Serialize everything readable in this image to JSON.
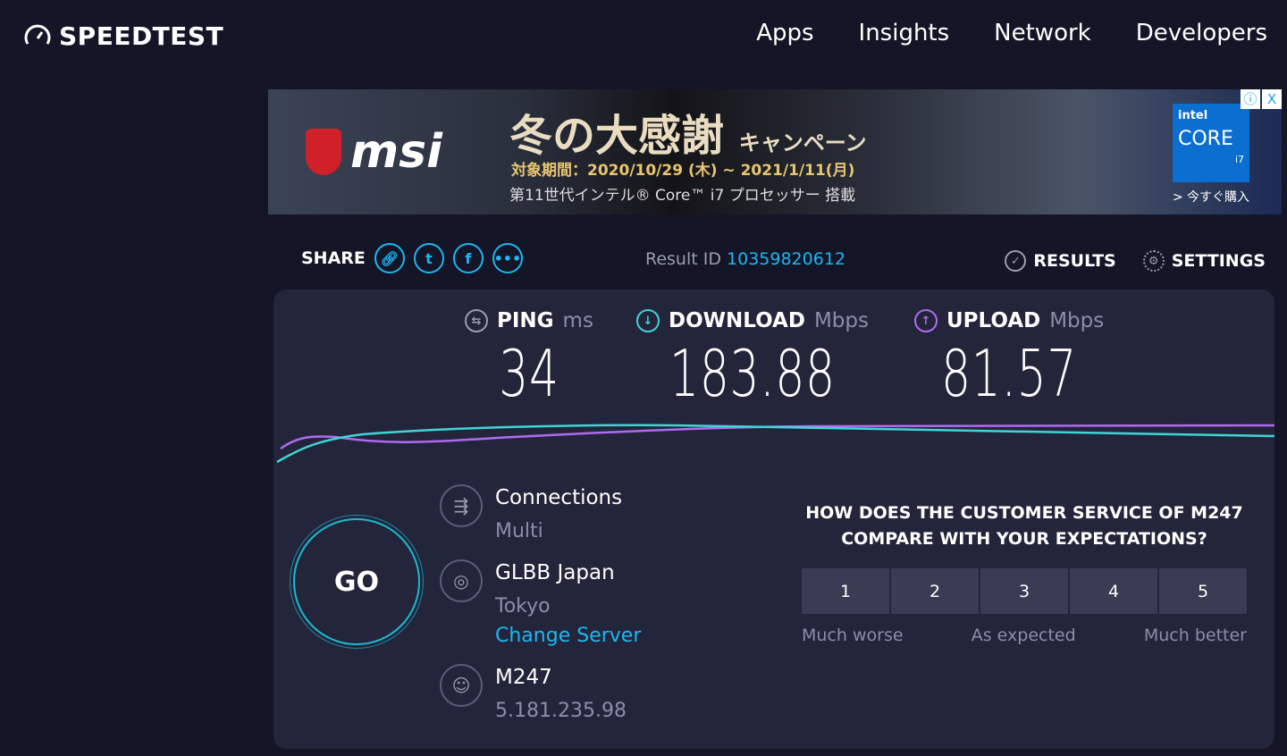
{
  "header": {
    "logo": "SPEEDTEST",
    "nav": [
      "Apps",
      "Insights",
      "Network",
      "Developers"
    ]
  },
  "ad": {
    "brand": "msi",
    "title": "冬の大感謝",
    "title_suffix": "キャンペーン",
    "period": "対象期間：2020/10/29 (木) ~ 2021/1/11(月)",
    "subtitle": "第11世代インテル® Core™ i7 プロセッサー 搭載",
    "intel_brand": "intel",
    "intel_core": "CORE",
    "intel_model": "i7",
    "buy": "> 今すぐ購入",
    "info": "ⓘ",
    "close": "X"
  },
  "share": {
    "label": "SHARE",
    "icons": [
      "link-icon",
      "twitter-icon",
      "facebook-icon",
      "more-icon"
    ]
  },
  "result": {
    "label": "Result ID",
    "id": "10359820612"
  },
  "actions": {
    "results": "RESULTS",
    "settings": "SETTINGS"
  },
  "metrics": {
    "ping": {
      "label": "PING",
      "unit": "ms",
      "value": "34"
    },
    "download": {
      "label": "DOWNLOAD",
      "unit": "Mbps",
      "value": "183.88"
    },
    "upload": {
      "label": "UPLOAD",
      "unit": "Mbps",
      "value": "81.57"
    }
  },
  "colors": {
    "accent": "#1cb7f2",
    "download": "#3fd6d6",
    "upload": "#b06bf2"
  },
  "go": "GO",
  "connections": {
    "label": "Connections",
    "value": "Multi"
  },
  "server": {
    "name": "GLBB Japan",
    "location": "Tokyo",
    "change": "Change Server"
  },
  "isp": {
    "name": "M247",
    "ip": "5.181.235.98"
  },
  "survey": {
    "question_line1": "HOW DOES THE CUSTOMER SERVICE OF M247",
    "question_line2": "COMPARE WITH YOUR EXPECTATIONS?",
    "options": [
      "1",
      "2",
      "3",
      "4",
      "5"
    ],
    "low": "Much worse",
    "mid": "As expected",
    "high": "Much better"
  }
}
